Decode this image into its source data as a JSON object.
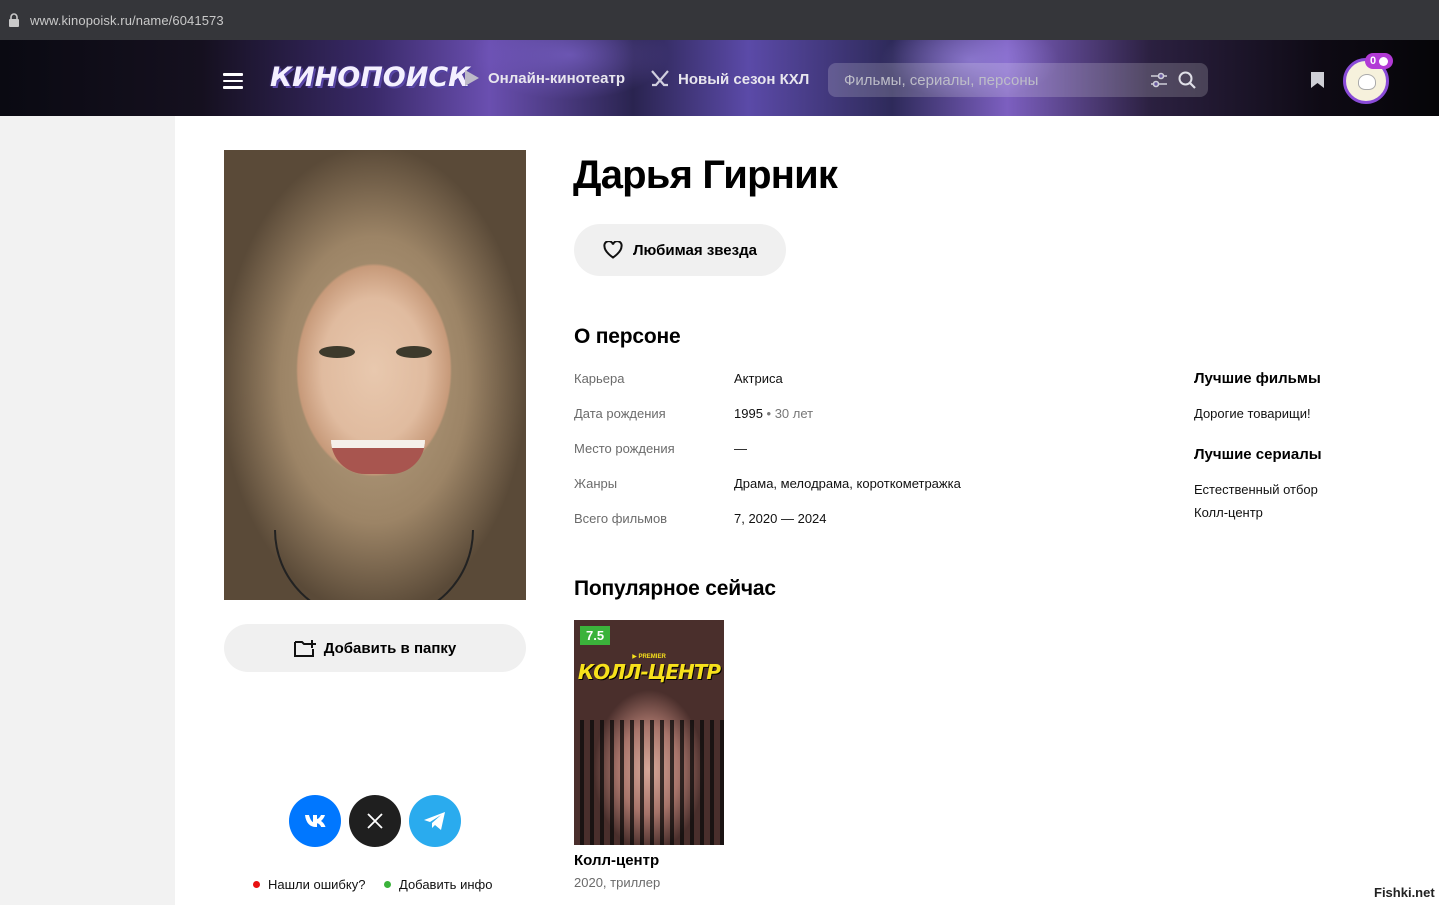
{
  "browser": {
    "url_domain": "www.kinopoisk.ru",
    "url_path": "/name/6041573"
  },
  "header": {
    "logo": "КИНОПОИСК",
    "nav": [
      {
        "label": "Онлайн-кинотеатр",
        "icon": "play-icon"
      },
      {
        "label": "Новый сезон КХЛ",
        "icon": "hockey-sticks-icon"
      }
    ],
    "search_placeholder": "Фильмы, сериалы, персоны",
    "badge_count": "0"
  },
  "person": {
    "name": "Дарья Гирник",
    "favorite_label": "Любимая звезда",
    "add_folder_label": "Добавить в папку"
  },
  "about": {
    "title": "О персоне",
    "rows": [
      {
        "label": "Карьера",
        "value": "Актриса"
      },
      {
        "label": "Дата рождения",
        "value": "1995",
        "extra": " • 30 лет"
      },
      {
        "label": "Место рождения",
        "value": "—"
      },
      {
        "label": "Жанры",
        "value": "Драма, мелодрама, короткометражка"
      },
      {
        "label": "Всего фильмов",
        "value": "7, 2020 — 2024"
      }
    ]
  },
  "best": {
    "films_title": "Лучшие фильмы",
    "films": [
      "Дорогие товарищи!"
    ],
    "series_title": "Лучшие сериалы",
    "series": [
      "Естественный отбор",
      "Колл-центр"
    ]
  },
  "popular": {
    "title": "Популярное сейчас",
    "items": [
      {
        "rating": "7.5",
        "title": "Колл-центр",
        "meta": "2020, триллер",
        "poster_text": "КОЛЛ-ЦЕНТР",
        "poster_sub": "▶ PREMIER"
      }
    ]
  },
  "footer": {
    "report_error": "Нашли ошибку?",
    "add_info": "Добавить инфо",
    "colors": {
      "report": "#e81010",
      "add": "#3bb33b"
    }
  },
  "watermark": "Fishki.net",
  "colors": {
    "vk": "#0077ff",
    "x": "#1f1f1f",
    "telegram": "#2aabee"
  }
}
